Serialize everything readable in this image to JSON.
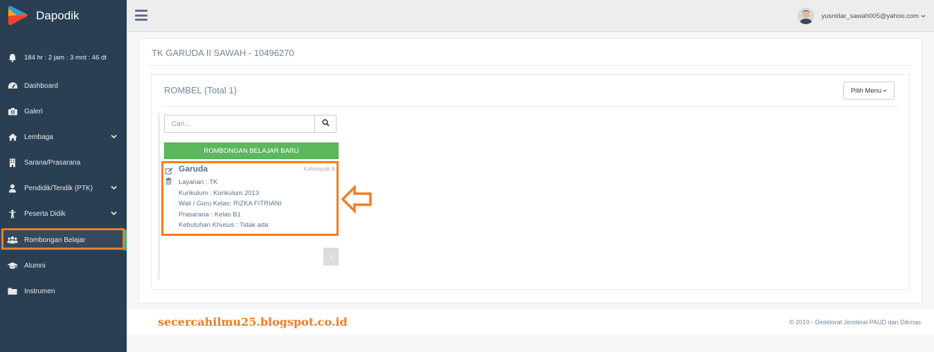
{
  "app": {
    "name": "Dapodik"
  },
  "sidebar": {
    "timer": "184 hr : 2 jam : 3 mnt : 46 dt",
    "items": [
      {
        "label": "Dashboard",
        "icon": "dashboard-icon"
      },
      {
        "label": "Galeri",
        "icon": "camera-icon"
      },
      {
        "label": "Lembaga",
        "icon": "home-icon",
        "expandable": true
      },
      {
        "label": "Sarana/Prasarana",
        "icon": "building-icon"
      },
      {
        "label": "Pendidik/Tendik (PTK)",
        "icon": "user-icon",
        "expandable": true
      },
      {
        "label": "Peserta Didik",
        "icon": "child-icon",
        "expandable": true
      },
      {
        "label": "Rombongan Belajar",
        "icon": "users-icon",
        "active": true
      },
      {
        "label": "Alumni",
        "icon": "graduation-cap-icon"
      },
      {
        "label": "Instrumen",
        "icon": "folder-icon"
      }
    ]
  },
  "topbar": {
    "user_email": "yusnidar_sawah005@yahoo.com"
  },
  "panel": {
    "title": "TK GARUDA II SAWAH - 10496270"
  },
  "rombel": {
    "title": "ROMBEL (Total 1)",
    "pilih_menu": "Pilih Menu",
    "search_placeholder": "Cari...",
    "new_button": "ROMBONGAN BELAJAR BARU",
    "card": {
      "name": "Garuda",
      "kelompok": "Kelompok A",
      "layanan": "Layanan : TK",
      "kurikulum": "Kurikulum : Kurikulum 2013",
      "wali": "Wali / Guru Kelas: RIZKA FITRIANI",
      "prasarana": "Prasarana : Kelas B1",
      "kebutuhan": "Kebutuhan Khusus : Tidak ada"
    },
    "page": "1"
  },
  "footer": {
    "watermark": "secercahilmu25.blogspot.co.id",
    "copyright": "©   2019 - Direktorat Jenderal PAUD dan Dikmas"
  },
  "colors": {
    "sidebar": "#2a3f54",
    "accent_highlight": "#f47d20",
    "success": "#5cb85c"
  }
}
